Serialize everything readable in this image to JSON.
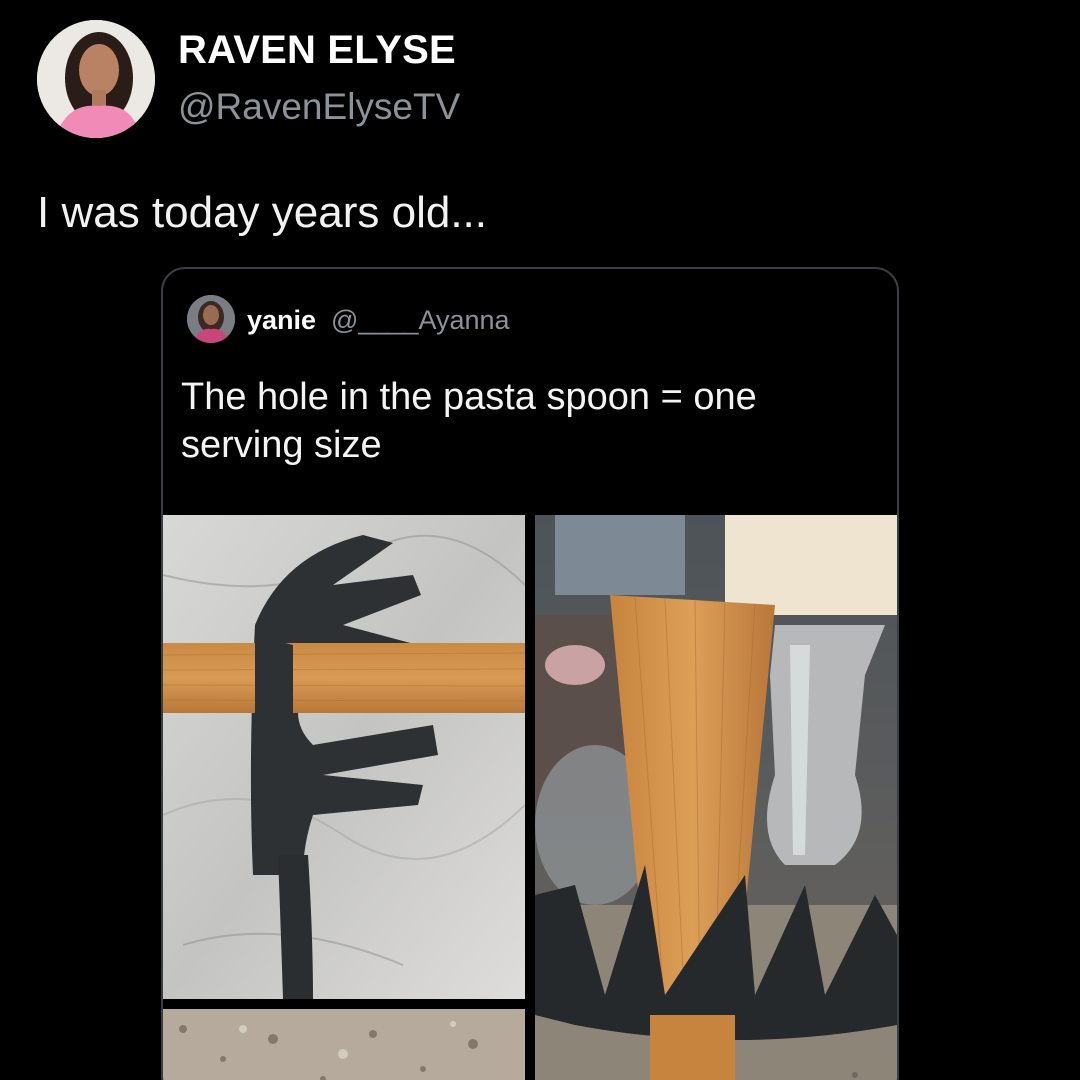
{
  "author": {
    "name": "RAVEN ELYSE",
    "handle": "@RavenElyseTV",
    "avatar_icon": "profile-photo"
  },
  "tweet": {
    "text": "I was today years old..."
  },
  "quoted_tweet": {
    "name": "yanie",
    "handle": "@____Ayanna",
    "avatar_icon": "profile-photo",
    "text": "The hole in the pasta spoon = one serving size",
    "media": [
      {
        "name": "pasta-spoon-marble-photo"
      },
      {
        "name": "pasta-spoon-standing-photo"
      },
      {
        "name": "granite-counter-photo"
      }
    ]
  },
  "colors": {
    "background": "#000000",
    "secondary_text": "#8b9298",
    "card_border": "#3a3f44"
  }
}
